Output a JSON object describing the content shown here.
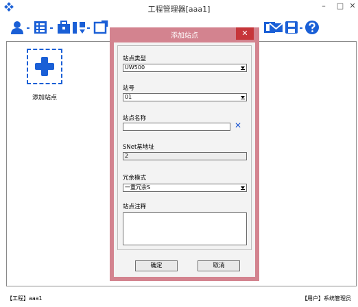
{
  "window": {
    "title": "工程管理器[aaa1]",
    "minimize": "–",
    "maximize": "□",
    "close": "✕"
  },
  "main": {
    "station_label": "添加站点"
  },
  "status": {
    "project": "【工程】aaa1",
    "user": "【用户】系统管理员"
  },
  "dialog": {
    "title": "添加站点",
    "close": "✕",
    "fields": {
      "station_type_label": "站点类型",
      "station_type_value": "UW500",
      "station_no_label": "站号",
      "station_no_value": "01",
      "station_name_label": "站点名称",
      "station_name_value": "",
      "clear": "✕",
      "snet_label": "SNet基地址",
      "snet_value": "2",
      "redundancy_label": "冗余模式",
      "redundancy_value": "一重冗余S",
      "note_label": "站点注释",
      "note_value": ""
    },
    "ok": "确定",
    "cancel": "取消"
  },
  "colors": {
    "accent_blue": "#1a5fd6",
    "dialog_frame": "#d3838f",
    "close_red": "#c6363a"
  }
}
